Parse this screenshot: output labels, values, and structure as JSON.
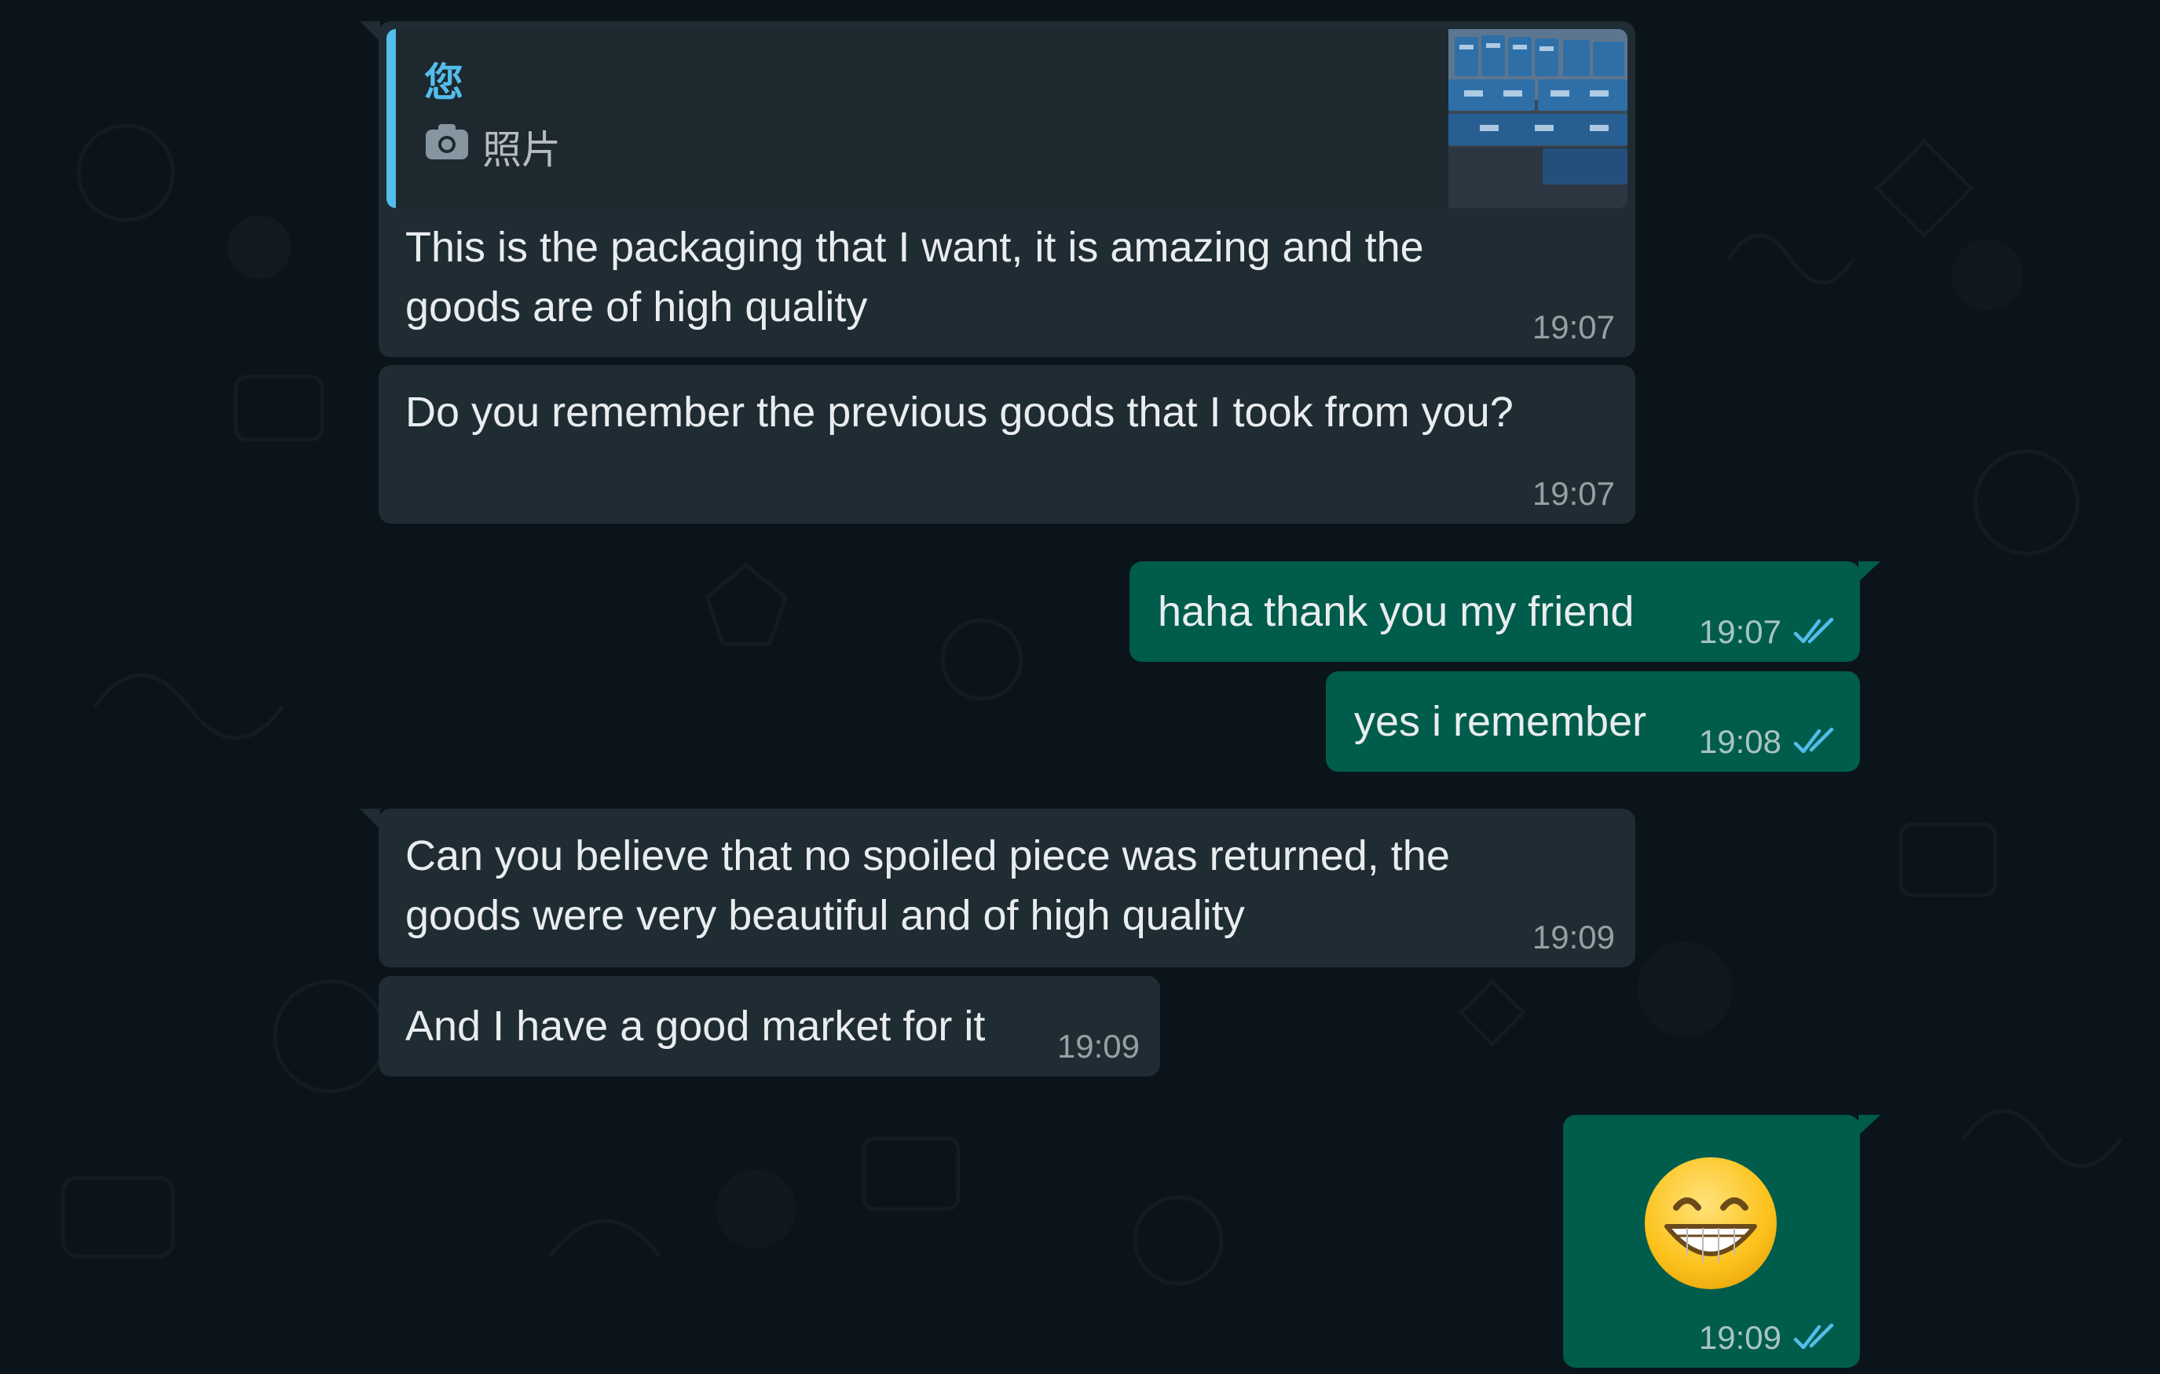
{
  "chat": {
    "messages": [
      {
        "direction": "incoming",
        "quote": {
          "author": "您",
          "icon": "camera-icon",
          "label": "照片"
        },
        "lines": [
          "This is the packaging that I want, it is amazing and the",
          "goods are of high quality"
        ],
        "time": "19:07"
      },
      {
        "direction": "incoming",
        "lines": [
          "Do you remember the previous goods that I took from you?"
        ],
        "time": "19:07"
      },
      {
        "direction": "outgoing",
        "lines": [
          "haha thank you my friend"
        ],
        "time": "19:07",
        "status": "read-double-check-icon"
      },
      {
        "direction": "outgoing",
        "lines": [
          "yes i remember"
        ],
        "time": "19:08",
        "status": "read-double-check-icon"
      },
      {
        "direction": "incoming",
        "lines": [
          "Can you believe that no spoiled piece was returned, the",
          "goods were very beautiful and of high quality"
        ],
        "time": "19:09"
      },
      {
        "direction": "incoming",
        "lines": [
          "And I have a good market for it"
        ],
        "time": "19:09"
      },
      {
        "direction": "outgoing",
        "emoji": "grinning-face-with-smiling-eyes-emoji",
        "time": "19:09",
        "status": "read-double-check-icon"
      }
    ]
  },
  "colors": {
    "background": "#0b141a",
    "incoming_bubble": "#202c33",
    "outgoing_bubble": "#005c4b",
    "quote_accent": "#53bdeb",
    "read_ticks": "#53bdeb"
  }
}
